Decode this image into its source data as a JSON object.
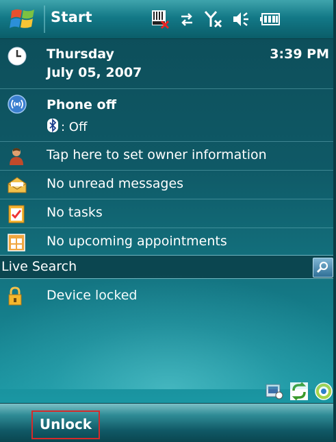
{
  "titlebar": {
    "start_label": "Start"
  },
  "status_icons": [
    "memory-card-warning-icon",
    "connectivity-arrows-icon",
    "signal-off-icon",
    "speaker-icon",
    "battery-icon"
  ],
  "today": {
    "date": {
      "weekday": "Thursday",
      "date": "July 05, 2007",
      "time": "3:39 PM"
    },
    "phone": {
      "title": "Phone off",
      "bluetooth_status": ": Off"
    },
    "owner": {
      "label": "Tap here to set owner information"
    },
    "messages": {
      "label": "No unread messages"
    },
    "tasks": {
      "label": "No tasks"
    },
    "appointments": {
      "label": "No upcoming appointments"
    },
    "search": {
      "label": "Live Search"
    },
    "lock": {
      "label": "Device locked"
    }
  },
  "tray_icons": [
    "sync-device-icon",
    "activesync-icon",
    "wireless-manager-icon"
  ],
  "softkeys": {
    "left_label": "Unlock"
  },
  "colors": {
    "accent": "#137987",
    "highlight_border": "#d62a2a"
  }
}
